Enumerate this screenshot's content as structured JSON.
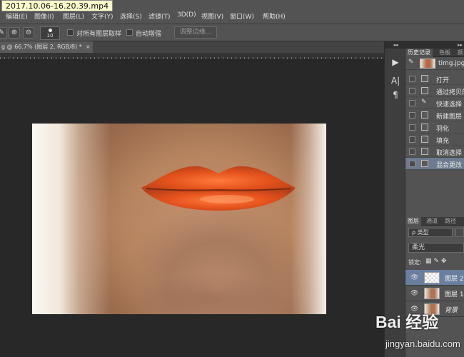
{
  "video_label": "2017.10.06-16.20.39.mp4",
  "menu": {
    "items": [
      "编辑(E)",
      "图像(I)",
      "图层(L)",
      "文字(Y)",
      "选择(S)",
      "滤镜(T)",
      "3D(D)",
      "视图(V)",
      "窗口(W)",
      "帮助(H)"
    ]
  },
  "options_bar": {
    "brush_size": "10",
    "sample_all_layers": "对所有图层取样",
    "auto_enhance": "自动增强",
    "refine_edge": "调整边缘..."
  },
  "document": {
    "tab_title": "g @ 66.7% (图层 2, RGB/8) *",
    "close_glyph": "×"
  },
  "colors": {
    "workspace": "#282828",
    "panel": "#535353",
    "selection": "#6e7b8f",
    "lip_color": "#e4521c"
  },
  "history_panel": {
    "tabs": [
      "历史记录",
      "色板",
      "颜"
    ],
    "snapshot": "timg.jpg",
    "items": [
      "打开",
      "通过拷贝的",
      "快速选择",
      "新建图层",
      "羽化",
      "填充",
      "取消选择",
      "混合更改"
    ],
    "selected_index": 7
  },
  "layers_panel": {
    "tabs": [
      "图层",
      "通道",
      "路径"
    ],
    "filter": "ρ 类型",
    "blend_mode": "柔光",
    "lock_label": "锁定:",
    "layers": [
      {
        "name": "图层 2",
        "selected": true,
        "italic": false
      },
      {
        "name": "图层 1",
        "selected": false,
        "italic": false
      },
      {
        "name": "背景",
        "selected": false,
        "italic": true
      }
    ]
  },
  "watermark": {
    "brand": "Bai 经验",
    "url": "jingyan.baidu.com"
  }
}
